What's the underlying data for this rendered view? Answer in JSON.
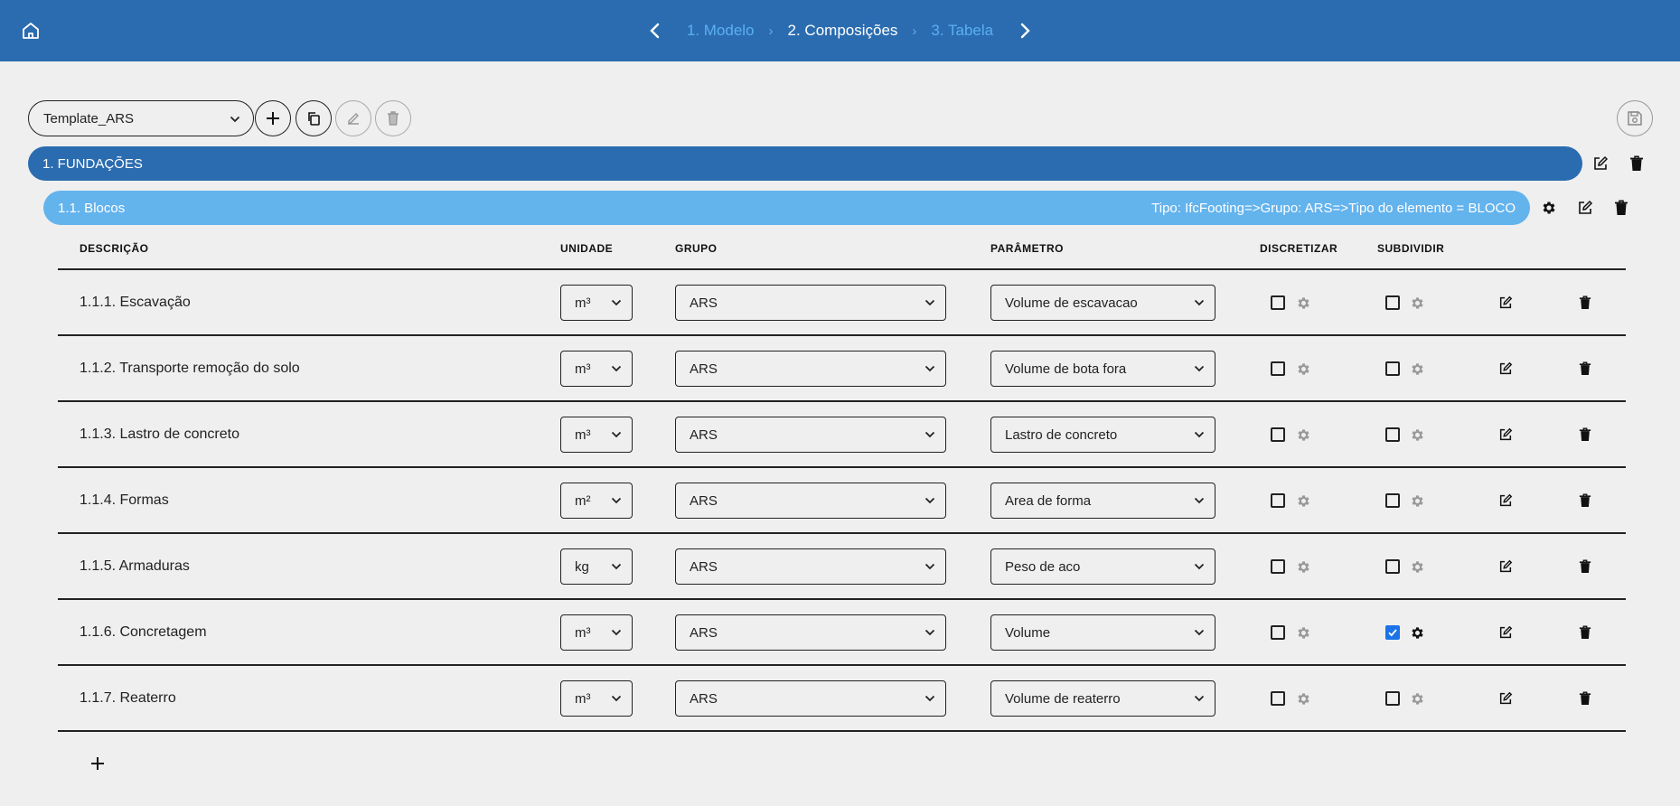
{
  "nav": {
    "steps": [
      {
        "label": "1. Modelo",
        "state": "inactive"
      },
      {
        "label": "2. Composições",
        "state": "active"
      },
      {
        "label": "3. Tabela",
        "state": "inactive"
      }
    ],
    "separator": "›"
  },
  "toolbar": {
    "template_value": "Template_ARS"
  },
  "group": {
    "label": "1. FUNDAÇÕES"
  },
  "subgroup": {
    "label": "1.1. Blocos",
    "filter": "Tipo: IfcFooting=>Grupo: ARS=>Tipo do elemento = BLOCO"
  },
  "table": {
    "headers": {
      "descricao": "DESCRIÇÃO",
      "unidade": "UNIDADE",
      "grupo": "GRUPO",
      "parametro": "PARÂMETRO",
      "discretizar": "DISCRETIZAR",
      "subdividir": "SUBDIVIDIR"
    },
    "rows": [
      {
        "desc": "1.1.1. Escavação",
        "unit": "m³",
        "group": "ARS",
        "param": "Volume de escavacao",
        "discretizar": false,
        "subdividir": false
      },
      {
        "desc": "1.1.2. Transporte remoção do solo",
        "unit": "m³",
        "group": "ARS",
        "param": "Volume de bota fora",
        "discretizar": false,
        "subdividir": false
      },
      {
        "desc": "1.1.3. Lastro de concreto",
        "unit": "m³",
        "group": "ARS",
        "param": "Lastro de concreto",
        "discretizar": false,
        "subdividir": false
      },
      {
        "desc": "1.1.4. Formas",
        "unit": "m²",
        "group": "ARS",
        "param": "Area de forma",
        "discretizar": false,
        "subdividir": false
      },
      {
        "desc": "1.1.5. Armaduras",
        "unit": "kg",
        "group": "ARS",
        "param": "Peso de aco",
        "discretizar": false,
        "subdividir": false
      },
      {
        "desc": "1.1.6. Concretagem",
        "unit": "m³",
        "group": "ARS",
        "param": "Volume",
        "discretizar": false,
        "subdividir": true
      },
      {
        "desc": "1.1.7. Reaterro",
        "unit": "m³",
        "group": "ARS",
        "param": "Volume de reaterro",
        "discretizar": false,
        "subdividir": false
      }
    ]
  },
  "colors": {
    "primary": "#2b6cb0",
    "secondary": "#63b3ed",
    "step_inactive": "#5ab0ee",
    "checkbox_checked": "#1a73e8",
    "background": "#efefef"
  },
  "icons": {
    "home": "home-icon",
    "prev": "chevron-left-icon",
    "next": "chevron-right-icon",
    "add": "plus-icon",
    "copy": "copy-icon",
    "edit": "edit-icon",
    "delete": "trash-icon",
    "save": "save-icon",
    "settings": "gear-icon"
  }
}
